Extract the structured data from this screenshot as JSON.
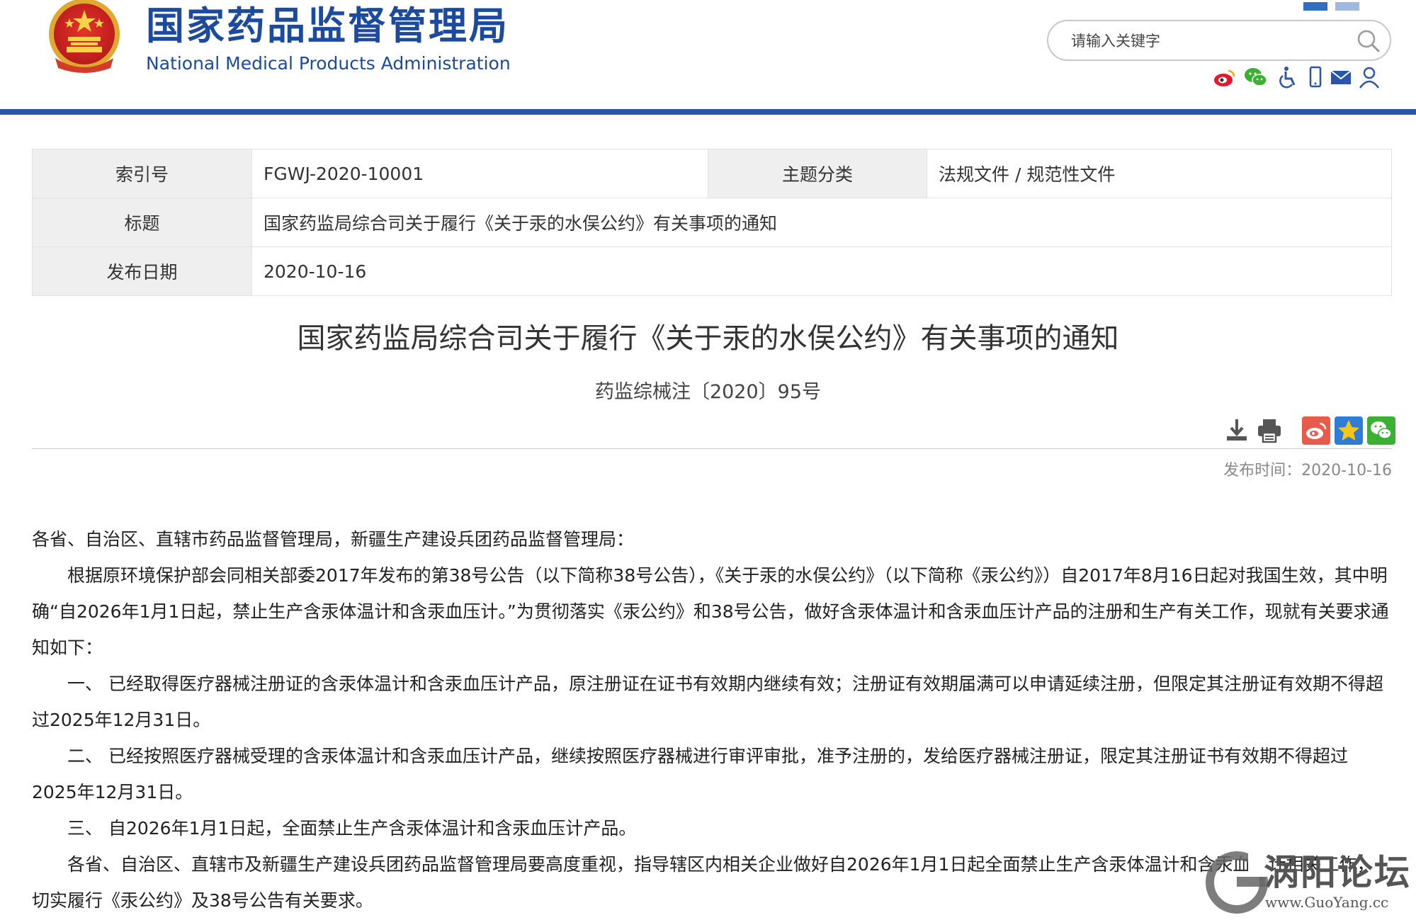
{
  "header": {
    "site_name_cn": "国家药品监督管理局",
    "site_name_en": "National Medical Products Administration",
    "search_placeholder": "请输入关键字",
    "social_icons": [
      "weibo-icon",
      "wechat-icon",
      "accessibility-icon",
      "mobile-icon",
      "mail-icon",
      "user-icon"
    ]
  },
  "info": {
    "index_label": "索引号",
    "index_value": "FGWJ-2020-10001",
    "category_label": "主题分类",
    "category_value": "法规文件 / 规范性文件",
    "title_label": "标题",
    "title_value": "国家药监局综合司关于履行《关于汞的水俣公约》有关事项的通知",
    "date_label": "发布日期",
    "date_value": "2020-10-16"
  },
  "article": {
    "title": "国家药监局综合司关于履行《关于汞的水俣公约》有关事项的通知",
    "doc_number": "药监综械注〔2020〕95号",
    "publish_time": "发布时间：2020-10-16",
    "paragraphs": [
      "各省、自治区、直辖市药品监督管理局，新疆生产建设兵团药品监督管理局：",
      "根据原环境保护部会同相关部委2017年发布的第38号公告（以下简称38号公告），《关于汞的水俣公约》（以下简称《汞公约》）自2017年8月16日起对我国生效，其中明确“自2026年1月1日起，禁止生产含汞体温计和含汞血压计。”为贯彻落实《汞公约》和38号公告，做好含汞体温计和含汞血压计产品的注册和生产有关工作，现就有关要求通知如下：",
      "一、 已经取得医疗器械注册证的含汞体温计和含汞血压计产品，原注册证在证书有效期内继续有效；注册证有效期届满可以申请延续注册，但限定其注册证有效期不得超过2025年12月31日。",
      "二、 已经按照医疗器械受理的含汞体温计和含汞血压计产品，继续按照医疗器械进行审评审批，准予注册的，发给医疗器械注册证，限定其注册证书有效期不得超过2025年12月31日。",
      "三、 自2026年1月1日起，全面禁止生产含汞体温计和含汞血压计产品。",
      "各省、自治区、直辖市及新疆生产建设兵团药品监督管理局要高度重视，指导辖区内相关企业做好自2026年1月1日起全面禁止生产含汞体温计和含汞血压计相关工作，切实履行《汞公约》及38号公告有关要求。"
    ]
  },
  "tools": [
    "download-icon",
    "print-icon",
    "share-weibo-icon",
    "favorite-icon",
    "share-wechat-icon"
  ],
  "watermark": {
    "name": "涡阳论坛",
    "url": "www.GuoYang.cc"
  },
  "colors": {
    "brand_blue": "#1c4a9c",
    "bar_blue": "#2b55a8",
    "label_bg": "#efefef"
  }
}
